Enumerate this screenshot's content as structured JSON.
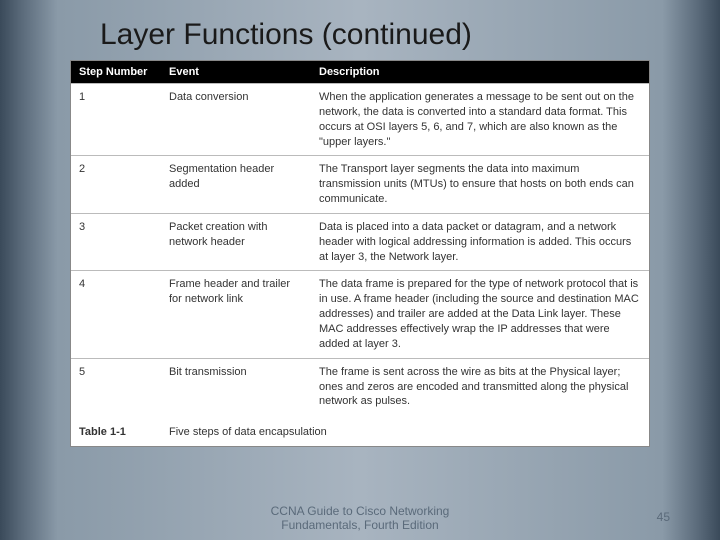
{
  "title": "Layer Functions (continued)",
  "chart_data": {
    "type": "table",
    "headers": [
      "Step Number",
      "Event",
      "Description"
    ],
    "rows": [
      [
        "1",
        "Data conversion",
        "When the application generates a message to be sent out on the network, the data is converted into a standard data format. This occurs at OSI layers 5, 6, and 7, which are also known as the \"upper layers.\""
      ],
      [
        "2",
        "Segmentation header added",
        "The Transport layer segments the data into maximum transmission units (MTUs) to ensure that hosts on both ends can communicate."
      ],
      [
        "3",
        "Packet creation with network header",
        "Data is placed into a data packet or datagram, and a network header with logical addressing information is added. This occurs at layer 3, the Network layer."
      ],
      [
        "4",
        "Frame header and trailer for network link",
        "The data frame is prepared for the type of network protocol that is in use. A frame header (including the source and destination MAC addresses) and trailer are added at the Data Link layer. These MAC addresses effectively wrap the IP addresses that were added at layer 3."
      ],
      [
        "5",
        "Bit transmission",
        "The frame is sent across the wire as bits at the Physical layer; ones and zeros are encoded and transmitted along the physical network as pulses."
      ]
    ],
    "caption_label": "Table 1-1",
    "caption_text": "Five steps of data encapsulation"
  },
  "footer": {
    "line1": "CCNA Guide to Cisco Networking",
    "line2": "Fundamentals, Fourth Edition"
  },
  "page_number": "45"
}
